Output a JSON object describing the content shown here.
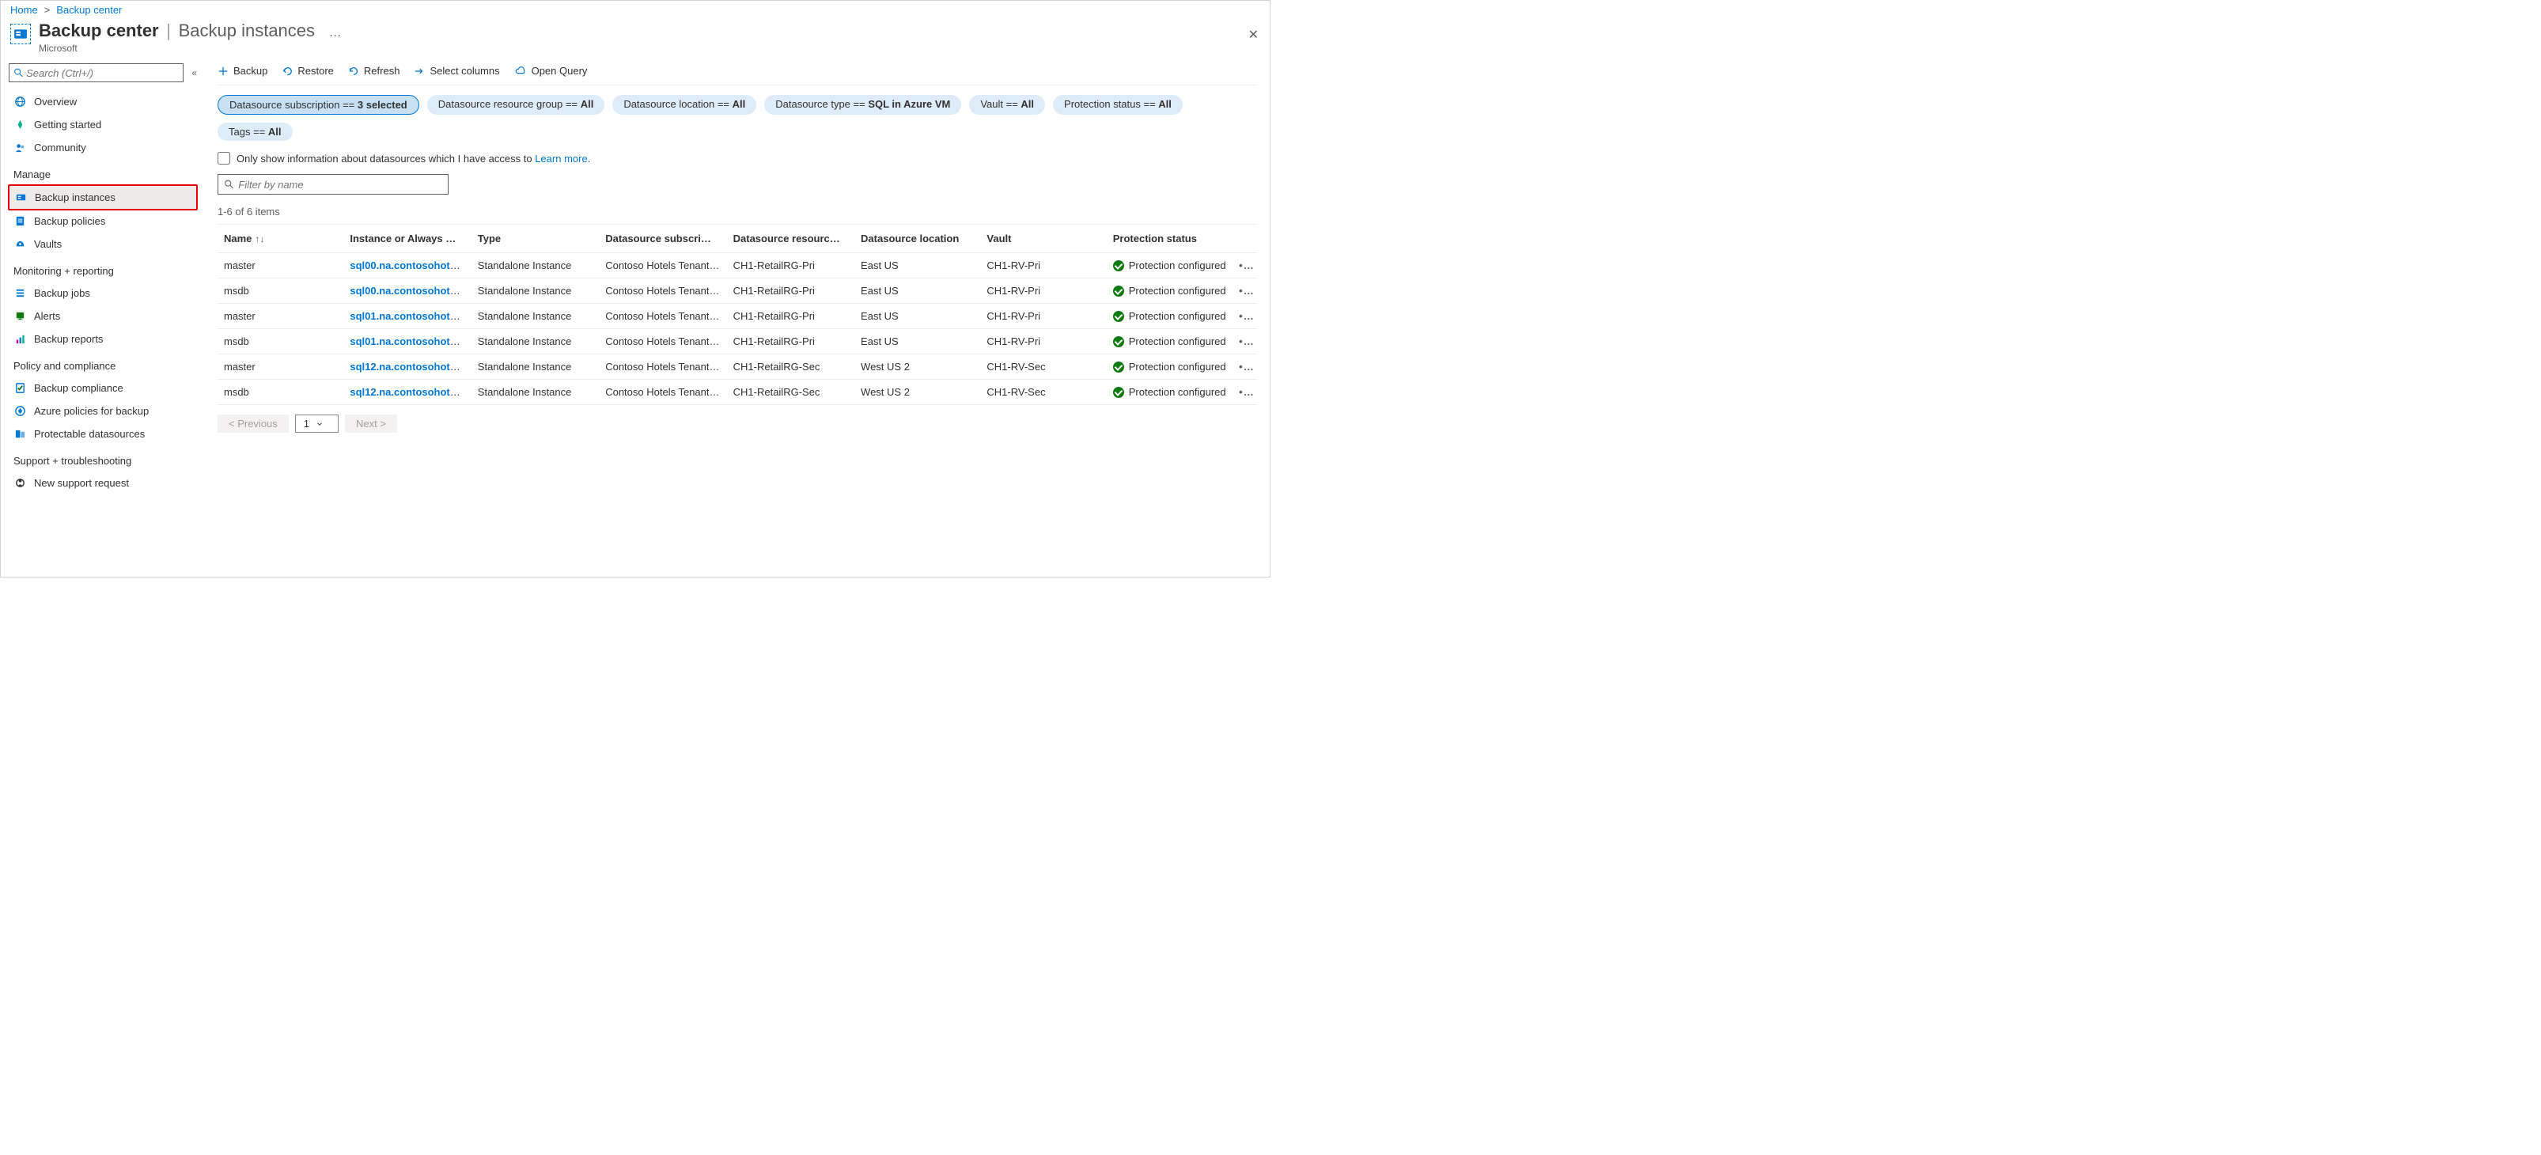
{
  "breadcrumb": {
    "home": "Home",
    "current": "Backup center"
  },
  "header": {
    "title": "Backup center",
    "subtitle": "Backup instances",
    "org": "Microsoft",
    "ellipsis": "…"
  },
  "sidebar": {
    "search_placeholder": "Search (Ctrl+/)",
    "items_top": [
      {
        "label": "Overview",
        "icon": "globe"
      },
      {
        "label": "Getting started",
        "icon": "rocket"
      },
      {
        "label": "Community",
        "icon": "people"
      }
    ],
    "group_manage": "Manage",
    "items_manage": [
      {
        "label": "Backup instances",
        "icon": "instance",
        "selected": true,
        "highlight": true
      },
      {
        "label": "Backup policies",
        "icon": "policies"
      },
      {
        "label": "Vaults",
        "icon": "vault"
      }
    ],
    "group_monitor": "Monitoring + reporting",
    "items_monitor": [
      {
        "label": "Backup jobs",
        "icon": "jobs"
      },
      {
        "label": "Alerts",
        "icon": "alerts"
      },
      {
        "label": "Backup reports",
        "icon": "reports"
      }
    ],
    "group_policy": "Policy and compliance",
    "items_policy": [
      {
        "label": "Backup compliance",
        "icon": "compliance"
      },
      {
        "label": "Azure policies for backup",
        "icon": "azpolicy"
      },
      {
        "label": "Protectable datasources",
        "icon": "protectable"
      }
    ],
    "group_support": "Support + troubleshooting",
    "items_support": [
      {
        "label": "New support request",
        "icon": "support"
      }
    ]
  },
  "toolbar": {
    "backup": "Backup",
    "restore": "Restore",
    "refresh": "Refresh",
    "columns": "Select columns",
    "query": "Open Query"
  },
  "filters": [
    {
      "prefix": "Datasource subscription == ",
      "value": "3 selected",
      "selected": true
    },
    {
      "prefix": "Datasource resource group == ",
      "value": "All"
    },
    {
      "prefix": "Datasource location == ",
      "value": "All"
    },
    {
      "prefix": "Datasource type == ",
      "value": "SQL in Azure VM"
    },
    {
      "prefix": "Vault == ",
      "value": "All"
    },
    {
      "prefix": "Protection status == ",
      "value": "All"
    },
    {
      "prefix": "Tags == ",
      "value": "All"
    }
  ],
  "access": {
    "label": "Only show information about datasources which I have access to ",
    "link": "Learn more"
  },
  "filter_placeholder": "Filter by name",
  "count": "1-6 of 6 items",
  "columns": [
    "Name",
    "Instance or Always …",
    "Type",
    "Datasource subscri…",
    "Datasource resourc…",
    "Datasource location",
    "Vault",
    "Protection status"
  ],
  "rows": [
    {
      "name": "master",
      "instance": "sql00.na.contosohotels…",
      "type": "Standalone Instance",
      "sub": "Contoso Hotels Tenant -…",
      "rg": "CH1-RetailRG-Pri",
      "loc": "East US",
      "vault": "CH1-RV-Pri",
      "status": "Protection configured"
    },
    {
      "name": "msdb",
      "instance": "sql00.na.contosohotels…",
      "type": "Standalone Instance",
      "sub": "Contoso Hotels Tenant -…",
      "rg": "CH1-RetailRG-Pri",
      "loc": "East US",
      "vault": "CH1-RV-Pri",
      "status": "Protection configured"
    },
    {
      "name": "master",
      "instance": "sql01.na.contosohotels…",
      "type": "Standalone Instance",
      "sub": "Contoso Hotels Tenant -…",
      "rg": "CH1-RetailRG-Pri",
      "loc": "East US",
      "vault": "CH1-RV-Pri",
      "status": "Protection configured"
    },
    {
      "name": "msdb",
      "instance": "sql01.na.contosohotels…",
      "type": "Standalone Instance",
      "sub": "Contoso Hotels Tenant -…",
      "rg": "CH1-RetailRG-Pri",
      "loc": "East US",
      "vault": "CH1-RV-Pri",
      "status": "Protection configured"
    },
    {
      "name": "master",
      "instance": "sql12.na.contosohotels…",
      "type": "Standalone Instance",
      "sub": "Contoso Hotels Tenant -…",
      "rg": "CH1-RetailRG-Sec",
      "loc": "West US 2",
      "vault": "CH1-RV-Sec",
      "status": "Protection configured"
    },
    {
      "name": "msdb",
      "instance": "sql12.na.contosohotels…",
      "type": "Standalone Instance",
      "sub": "Contoso Hotels Tenant -…",
      "rg": "CH1-RetailRG-Sec",
      "loc": "West US 2",
      "vault": "CH1-RV-Sec",
      "status": "Protection configured"
    }
  ],
  "pager": {
    "prev": "< Previous",
    "page": "1",
    "next": "Next >"
  }
}
